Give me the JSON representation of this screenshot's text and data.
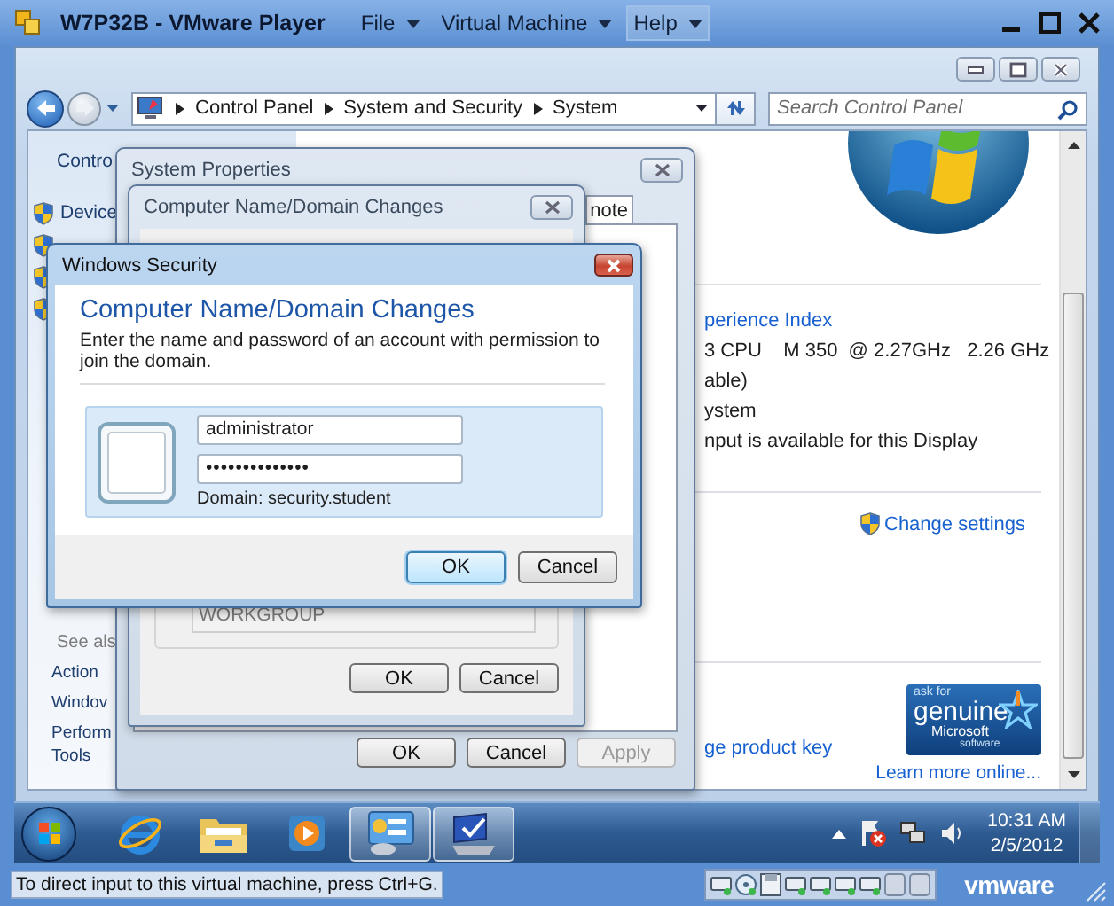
{
  "player": {
    "title": "W7P32B - VMware Player",
    "menus": [
      {
        "label": "File",
        "selected": false
      },
      {
        "label": "Virtual Machine",
        "selected": false
      },
      {
        "label": "Help",
        "selected": true
      }
    ]
  },
  "explorer": {
    "breadcrumb": [
      "Control Panel",
      "System and Security",
      "System"
    ],
    "search": {
      "placeholder": "Search Control Panel"
    }
  },
  "left_pane": {
    "heading": "Contro",
    "tasks": [
      "Device"
    ],
    "see_also": {
      "heading": "See als",
      "links": [
        [
          "Action"
        ],
        [
          "Windov"
        ],
        [
          "Perform",
          "Tools"
        ]
      ]
    }
  },
  "system_info": {
    "rating_link": "perience Index",
    "lines": [
      "3 CPU    M 350  @ 2.27GHz   2.26 GHz",
      "able)",
      "ystem",
      "nput is available for this Display"
    ]
  },
  "computer_name": {
    "change_settings": "Change settings"
  },
  "activation": {
    "product_key_link": "ge product key",
    "badge": [
      "ask for",
      "genuine",
      "Microsoft",
      "software"
    ],
    "learn_more": "Learn more online..."
  },
  "system_properties": {
    "title": "System Properties",
    "tab": "note",
    "buttons": [
      {
        "label": "OK",
        "disabled": false
      },
      {
        "label": "Cancel",
        "disabled": false
      },
      {
        "label": "Apply",
        "disabled": true
      }
    ]
  },
  "name_changes": {
    "title": "Computer Name/Domain Changes",
    "workgroup": {
      "value": "WORKGROUP",
      "disabled": true
    },
    "buttons": [
      "OK",
      "Cancel"
    ]
  },
  "security": {
    "title": "Windows Security",
    "heading": "Computer Name/Domain Changes",
    "message": "Enter the name and password of an account with permission to join the domain.",
    "username": "administrator",
    "password": "••••••••••••••",
    "domain": "Domain: security.student",
    "buttons": [
      {
        "label": "OK",
        "default": true
      },
      {
        "label": "Cancel",
        "default": false
      }
    ]
  },
  "taskbar": {
    "apps": [
      {
        "kind": "browser",
        "active": false
      },
      {
        "kind": "folder",
        "active": false
      },
      {
        "kind": "media",
        "active": false
      },
      {
        "kind": "control-panel",
        "active": true
      },
      {
        "kind": "monitor",
        "active": true
      }
    ],
    "clock": {
      "time": "10:31 AM",
      "date": "2/5/2012"
    }
  },
  "status": {
    "message": "To direct input to this virtual machine, press Ctrl+G.",
    "logo": "vmware"
  }
}
